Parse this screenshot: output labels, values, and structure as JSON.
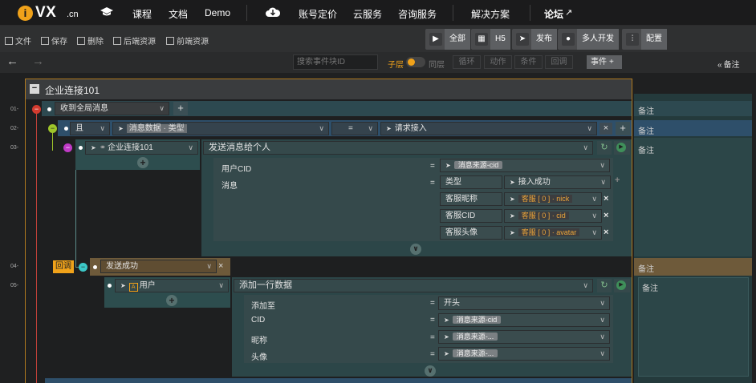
{
  "topnav": {
    "logo_text": "VX",
    "logo_suffix": ".cn",
    "items": [
      "课程",
      "文档",
      "Demo",
      "账号定价",
      "云服务",
      "咨询服务",
      "解决方案",
      "论坛"
    ]
  },
  "toolbar": {
    "file": "文件",
    "save": "保存",
    "delete": "删除",
    "backend": "后端资源",
    "frontend": "前端资源",
    "btn_all": "全部",
    "btn_h5": "H5",
    "btn_publish": "发布",
    "btn_multi": "多人开发",
    "btn_config": "配置"
  },
  "subbar": {
    "search_placeholder": "搜索事件块ID",
    "child_layer": "子层",
    "same_layer": "同层",
    "loop": "循环",
    "action": "动作",
    "condition": "条件",
    "callback": "回调",
    "event": "事件",
    "notes": "备注"
  },
  "panel": {
    "title": "企业连接101",
    "row_numbers": [
      "01-",
      "02-",
      "03-",
      "04-",
      "05-"
    ],
    "row1_event": "收到全局消息",
    "row2_and": "且",
    "row2_field": "消息数据 · 类型",
    "row2_op": "=",
    "row2_value": "请求接入",
    "row3_object": "企业连接101",
    "row3_action": "发送消息给个人",
    "param_user_cid_label": "用户CID",
    "param_user_cid_value": "消息来源-cid",
    "param_message_label": "消息",
    "kv_type_key": "类型",
    "kv_type_value": "接入成功",
    "kv_nick_key": "客服昵称",
    "kv_nick_value": "客服 [ 0 ] · nick",
    "kv_cid_key": "客服CID",
    "kv_cid_value": "客服 [ 0 ] · cid",
    "kv_avatar_key": "客服头像",
    "kv_avatar_value": "客服 [ 0 ] · avatar",
    "callback_tag": "回调",
    "row4_event": "发送成功",
    "row5_object": "用户",
    "row5_action": "添加一行数据",
    "add_to_label": "添加至",
    "add_to_value": "开头",
    "cid_label": "CID",
    "cid_value": "消息来源-cid",
    "nick_label": "昵称",
    "nick_value": "消息来源-...",
    "avatar_label": "头像",
    "avatar_value": "消息来源-...",
    "eq": "=",
    "notes": [
      "备注",
      "备注",
      "备注",
      "备注",
      "备注"
    ]
  },
  "colors": {
    "accent": "#f0a21a",
    "row_teal": "#33565e",
    "callback_brown": "#6e5a3a"
  }
}
